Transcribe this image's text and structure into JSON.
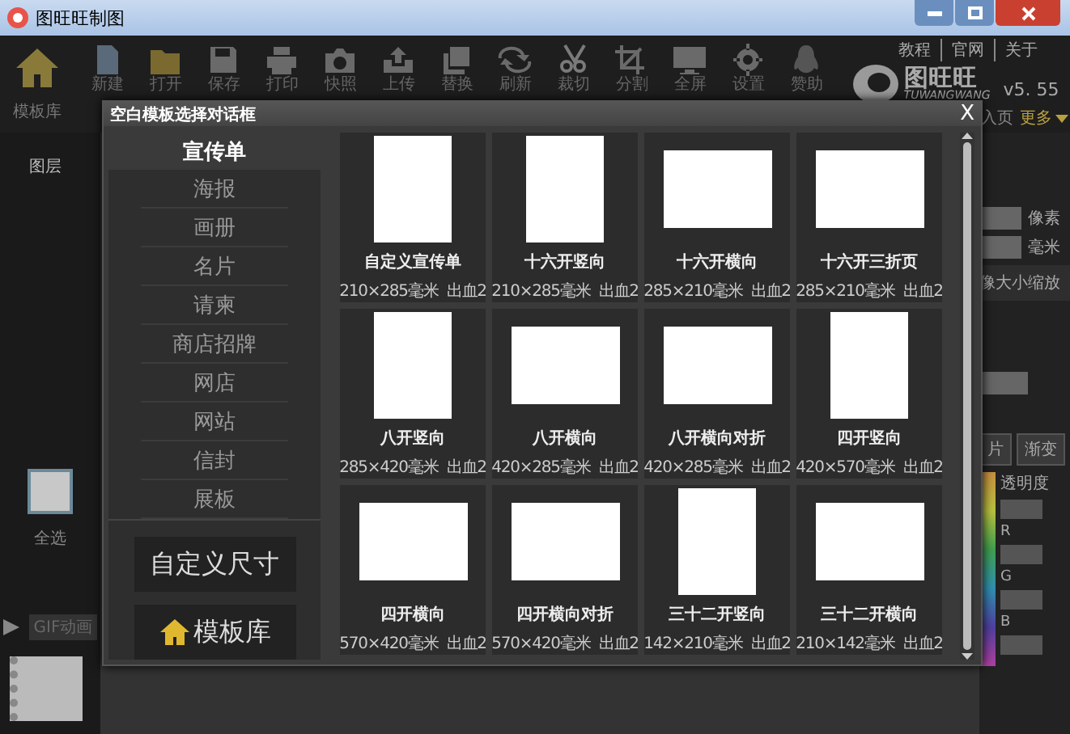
{
  "window": {
    "title": "图旺旺制图"
  },
  "toolbar": [
    {
      "label": "新建",
      "kind": "file"
    },
    {
      "label": "打开",
      "kind": "folder"
    },
    {
      "label": "保存",
      "kind": "save"
    },
    {
      "label": "打印",
      "kind": "print"
    },
    {
      "label": "快照",
      "kind": "camera"
    },
    {
      "label": "上传",
      "kind": "upload"
    },
    {
      "label": "替换",
      "kind": "copy"
    },
    {
      "label": "刷新",
      "kind": "refresh"
    },
    {
      "label": "裁切",
      "kind": "scissors"
    },
    {
      "label": "分割",
      "kind": "crop"
    },
    {
      "label": "全屏",
      "kind": "monitor"
    },
    {
      "label": "设置",
      "kind": "gear"
    },
    {
      "label": "赞助",
      "kind": "penguin"
    }
  ],
  "home": {
    "label": "模板库"
  },
  "links": [
    "教程",
    "官网",
    "关于"
  ],
  "logo": {
    "name": "图旺旺",
    "sub": "TUWANGWANG",
    "version": "v5. 55"
  },
  "nav": [
    "入页",
    "更多"
  ],
  "left_panel": {
    "title": "图层",
    "select_all": "全选",
    "gif": "GIF动画"
  },
  "right_panel": {
    "units": [
      "像素",
      "毫米"
    ],
    "scale_button": "像大小缩放",
    "tabs": [
      "片",
      "渐变"
    ],
    "opacity": "透明度",
    "channels": [
      "R",
      "G",
      "B"
    ]
  },
  "dialog": {
    "title": "空白模板选择对话框",
    "close": "X",
    "categories": [
      {
        "label": "宣传单",
        "selected": true
      },
      {
        "label": "海报",
        "selected": false
      },
      {
        "label": "画册",
        "selected": false
      },
      {
        "label": "名片",
        "selected": false
      },
      {
        "label": "请柬",
        "selected": false
      },
      {
        "label": "商店招牌",
        "selected": false
      },
      {
        "label": "网店",
        "selected": false
      },
      {
        "label": "网站",
        "selected": false
      },
      {
        "label": "信封",
        "selected": false
      },
      {
        "label": "展板",
        "selected": false
      }
    ],
    "custom_button": "自定义尺寸",
    "library_button": "模板库",
    "templates": [
      {
        "name": "自定义宣传单",
        "size": "210×285毫米",
        "bleed": "出血2",
        "kind": "portrait"
      },
      {
        "name": "十六开竖向",
        "size": "210×285毫米",
        "bleed": "出血2",
        "kind": "portrait"
      },
      {
        "name": "十六开横向",
        "size": "285×210毫米",
        "bleed": "出血2",
        "kind": "landscape"
      },
      {
        "name": "十六开三折页",
        "size": "285×210毫米",
        "bleed": "出血2",
        "kind": "landscape"
      },
      {
        "name": "八开竖向",
        "size": "285×420毫米",
        "bleed": "出血2",
        "kind": "portrait"
      },
      {
        "name": "八开横向",
        "size": "420×285毫米",
        "bleed": "出血2",
        "kind": "landscape"
      },
      {
        "name": "八开横向对折",
        "size": "420×285毫米",
        "bleed": "出血2",
        "kind": "landscape"
      },
      {
        "name": "四开竖向",
        "size": "420×570毫米",
        "bleed": "出血2",
        "kind": "portrait"
      },
      {
        "name": "四开横向",
        "size": "570×420毫米",
        "bleed": "出血2",
        "kind": "landscape"
      },
      {
        "name": "四开横向对折",
        "size": "570×420毫米",
        "bleed": "出血2",
        "kind": "landscape"
      },
      {
        "name": "三十二开竖向",
        "size": "142×210毫米",
        "bleed": "出血2",
        "kind": "portrait"
      },
      {
        "name": "三十二开横向",
        "size": "210×142毫米",
        "bleed": "出血2",
        "kind": "landscape"
      }
    ]
  }
}
